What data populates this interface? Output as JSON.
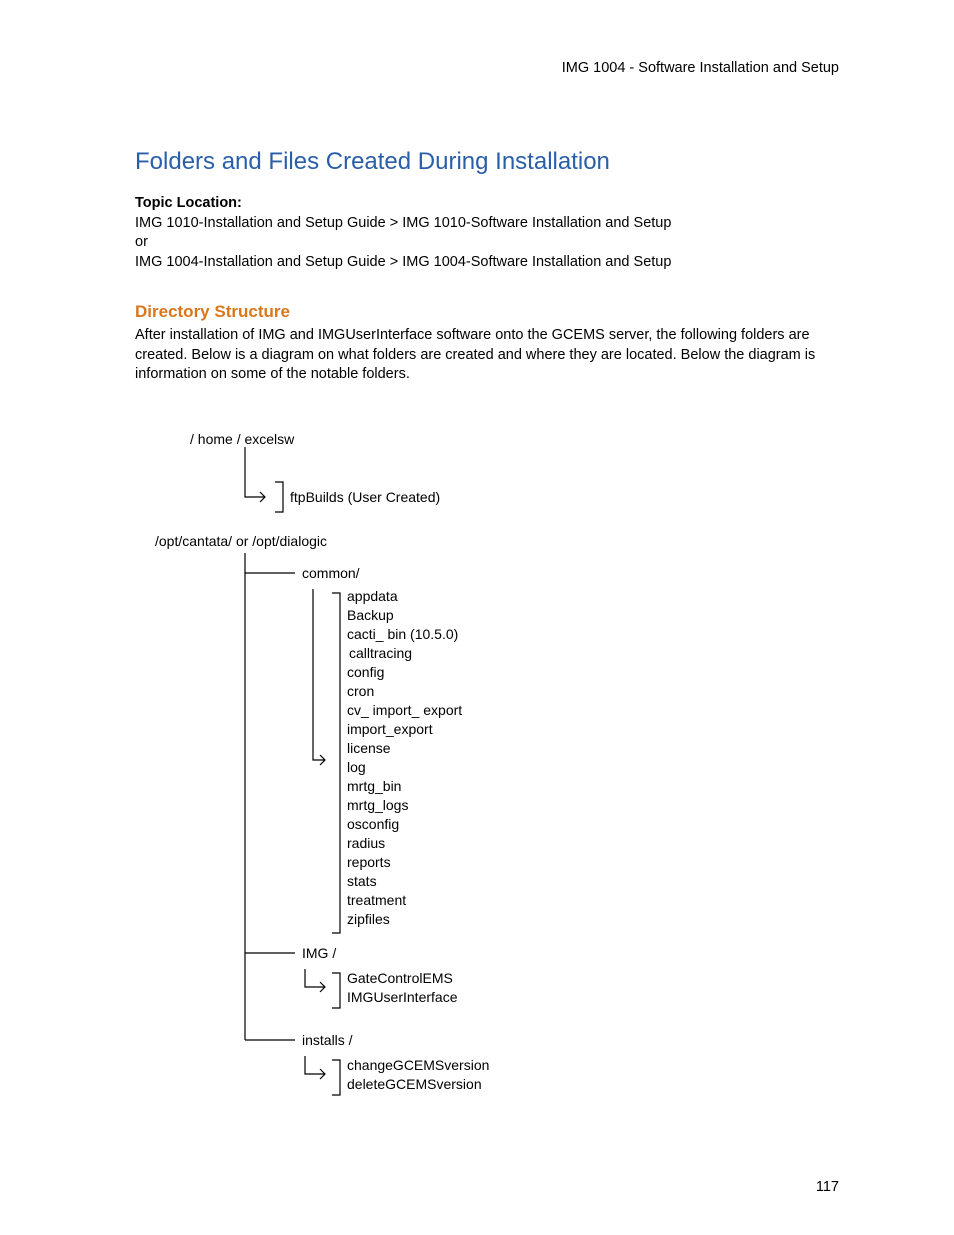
{
  "header": {
    "running": "IMG 1004 - Software Installation and Setup"
  },
  "title": "Folders and Files Created During Installation",
  "topic": {
    "label": "Topic Location:",
    "line1": "IMG 1010-Installation and Setup Guide  > IMG 1010-Software Installation and Setup",
    "or": "or",
    "line2": "IMG 1004-Installation and Setup Guide  > IMG 1004-Software Installation and Setup"
  },
  "section": {
    "heading": "Directory Structure",
    "body": "After installation of IMG and IMGUserInterface software onto the GCEMS server, the following folders are created. Below is a diagram on what folders are created and where they are located. Below the diagram is information on some of the notable folders."
  },
  "diagram": {
    "root1": "/ home / excelsw",
    "root1_child": "ftpBuilds (User Created)",
    "root2": "/opt/cantata/ or /opt/dialogic",
    "branch_common": "common/",
    "common_items": {
      "i0": "appdata",
      "i1": "Backup",
      "i2": "cacti_ bin (10.5.0)",
      "i3": "calltracing",
      "i4": "config",
      "i5": "cron",
      "i6": "cv_ import_ export",
      "i7": "import_export",
      "i8": "license",
      "i9": "log",
      "i10": "mrtg_bin",
      "i11": "mrtg_logs",
      "i12": "osconfig",
      "i13": "radius",
      "i14": "reports",
      "i15": "stats",
      "i16": "treatment",
      "i17": "zipfiles"
    },
    "branch_img": "IMG /",
    "img_items": {
      "i0": "GateControlEMS",
      "i1": "IMGUserInterface"
    },
    "branch_installs": "installs /",
    "installs_items": {
      "i0": "changeGCEMSversion",
      "i1": "deleteGCEMSversion"
    }
  },
  "page_number": "117"
}
